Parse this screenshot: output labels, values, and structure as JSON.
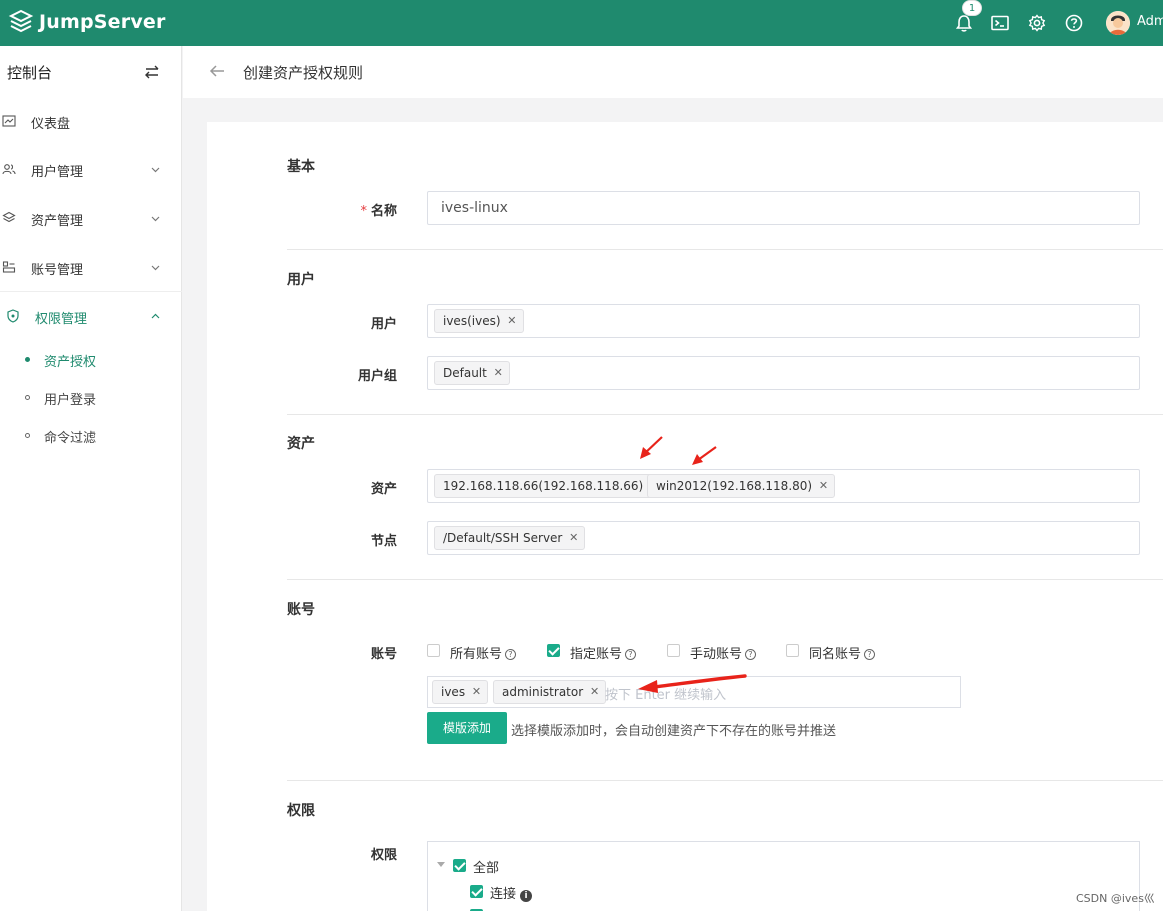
{
  "app": {
    "name": "JumpServer"
  },
  "header": {
    "notification_count": "1",
    "user_name": "Adm"
  },
  "sidebar": {
    "title": "控制台",
    "items": [
      {
        "label": "仪表盘"
      },
      {
        "label": "用户管理"
      },
      {
        "label": "资产管理"
      },
      {
        "label": "账号管理"
      },
      {
        "label": "权限管理"
      }
    ],
    "subitems": [
      {
        "label": "资产授权"
      },
      {
        "label": "用户登录"
      },
      {
        "label": "命令过滤"
      }
    ]
  },
  "page": {
    "title": "创建资产授权规则"
  },
  "sections": {
    "basic": "基本",
    "user": "用户",
    "asset": "资产",
    "account": "账号",
    "perm": "权限"
  },
  "form": {
    "name_label": "名称",
    "name_value": "ives-linux",
    "users_label": "用户",
    "users": [
      "ives(ives)"
    ],
    "groups_label": "用户组",
    "groups": [
      "Default"
    ],
    "assets_label": "资产",
    "assets": [
      "192.168.118.66(192.168.118.66)",
      "win2012(192.168.118.80)"
    ],
    "nodes_label": "节点",
    "nodes": [
      "/Default/SSH Server"
    ],
    "accounts_label": "账号",
    "account_options": [
      {
        "label": "所有账号",
        "checked": false
      },
      {
        "label": "指定账号",
        "checked": true
      },
      {
        "label": "手动账号",
        "checked": false
      },
      {
        "label": "同名账号",
        "checked": false
      }
    ],
    "accounts": [
      "ives",
      "administrator"
    ],
    "accounts_placeholder": "按下 Enter 继续输入",
    "template_button": "模版添加",
    "template_help": "选择模版添加时，会自动创建资产下不存在的账号并推送",
    "perm_label": "权限",
    "perm_tree": [
      {
        "label": "全部",
        "checked": true
      },
      {
        "label": "连接",
        "checked": true
      }
    ]
  },
  "watermark": "CSDN @ives巛",
  "colors": {
    "brand": "#1f8a6e",
    "primary": "#1aab8a",
    "annotation": "#e8231a"
  }
}
